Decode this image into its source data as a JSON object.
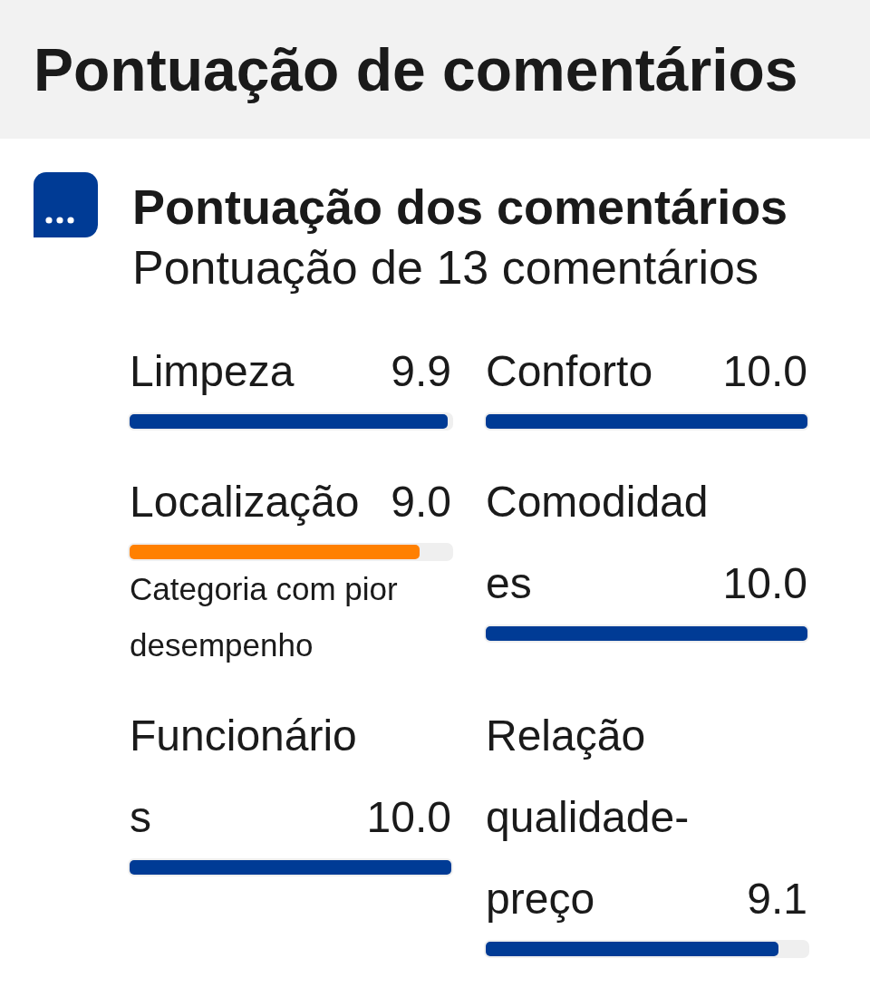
{
  "header": {
    "title": "Pontuação de comentários"
  },
  "summary": {
    "title": "Pontuação dos comentários",
    "subtitle": "Pontuação de 13 comentários"
  },
  "categories": [
    {
      "name": "Limpeza",
      "score": "9.9",
      "level": 0.99,
      "worst": false
    },
    {
      "name": "Conforto",
      "score": "10.0",
      "level": 1,
      "worst": false
    },
    {
      "name": "Localização",
      "score": "9.0",
      "level": 0.9,
      "worst": true,
      "note": "Categoria com pior desempenho"
    },
    {
      "name": "Comodidades",
      "score": "10.0",
      "level": 1,
      "worst": false
    },
    {
      "name": "Funcionários",
      "score": "10.0",
      "level": 1,
      "worst": false
    },
    {
      "name": "Relação qualidade-preço",
      "score": "9.1",
      "level": 0.91,
      "worst": false
    }
  ]
}
